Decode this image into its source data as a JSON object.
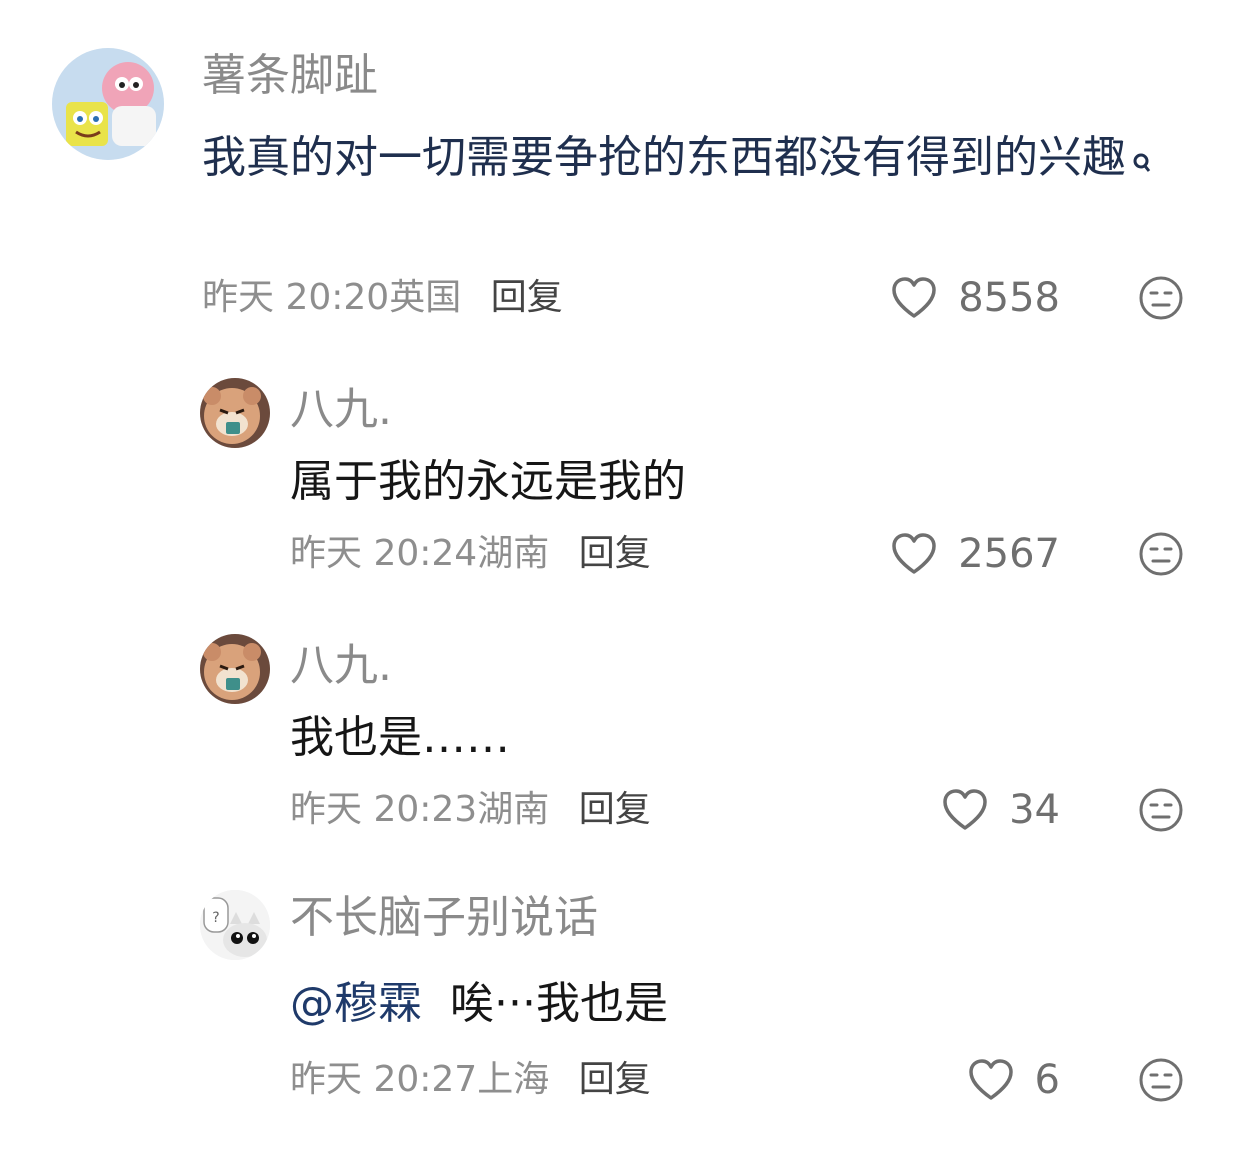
{
  "comments": [
    {
      "username": "薯条脚趾",
      "text": "我真的对一切需要争抢的东西都没有得到的兴趣",
      "date": "昨天",
      "time": "20:20",
      "location": "英国",
      "reply_label": "回复",
      "likes": "8558",
      "avatar": "spongebob-patrick-avatar"
    },
    {
      "username": "八九.",
      "text": "属于我的永远是我的",
      "date": "昨天",
      "time": "20:24",
      "location": "湖南",
      "reply_label": "回复",
      "likes": "2567",
      "avatar": "hamster-avatar"
    },
    {
      "username": "八九.",
      "text": "我也是……",
      "date": "昨天",
      "time": "20:23",
      "location": "湖南",
      "reply_label": "回复",
      "likes": "34",
      "avatar": "hamster-avatar"
    },
    {
      "username": "不长脑子别说话",
      "mention": "@穆霖",
      "text": "唉···我也是",
      "date": "昨天",
      "time": "20:27",
      "location": "上海",
      "reply_label": "回复",
      "likes": "6",
      "avatar": "cartoon-cat-avatar"
    }
  ],
  "colors": {
    "username": "#8a8a8a",
    "top_comment_text": "#1f2f4e",
    "reply_text": "#161616",
    "mention": "#1f3a6a",
    "meta": "#8e8e8e",
    "icon": "#6f6f6f"
  }
}
